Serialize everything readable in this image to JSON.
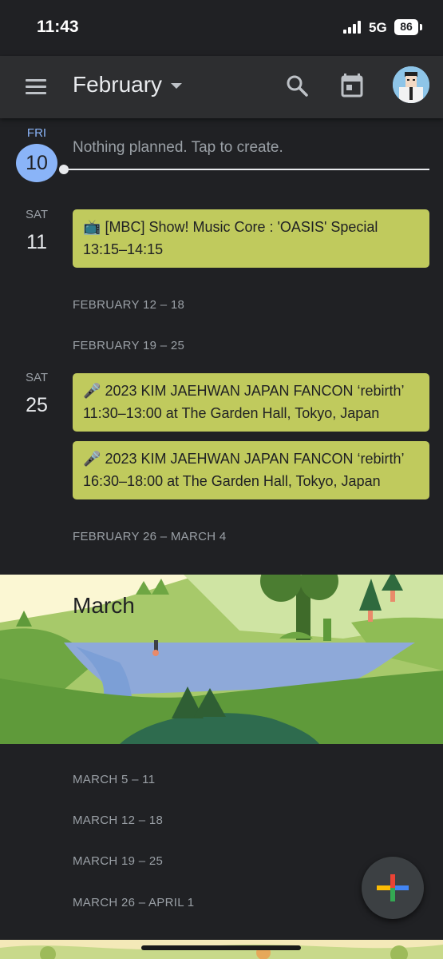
{
  "status_bar": {
    "time": "11:43",
    "network": "5G",
    "battery": "86"
  },
  "app_bar": {
    "title": "February",
    "icons": [
      "menu-icon",
      "search-icon",
      "calendar-today-icon",
      "avatar"
    ]
  },
  "colors": {
    "event": "#c0ca5d",
    "today": "#8ab4f8",
    "background": "#202124",
    "appbar": "#2d2e30"
  },
  "days": [
    {
      "dow": "FRI",
      "dom": "10",
      "today": true,
      "placeholder": "Nothing planned. Tap to create."
    },
    {
      "dow": "SAT",
      "dom": "11"
    },
    {
      "dow": "SAT",
      "dom": "25"
    }
  ],
  "events": [
    {
      "icon": "📺",
      "title": "[MBC] Show! Music Core : 'OASIS' Special",
      "time": "13:15–14:15"
    },
    {
      "icon": "🎤",
      "title": "2023 KIM JAEHWAN JAPAN FANCON ‘rebirth’",
      "time": "11:30–13:00 at The Garden Hall, Tokyo, Japan"
    },
    {
      "icon": "🎤",
      "title": "2023 KIM JAEHWAN JAPAN FANCON ‘rebirth’",
      "time": "16:30–18:00 at The Garden Hall, Tokyo, Japan"
    }
  ],
  "weeks": {
    "feb_12": "FEBRUARY 12 – 18",
    "feb_19": "FEBRUARY 19 – 25",
    "feb_26": "FEBRUARY 26 – MARCH 4",
    "mar_5": "MARCH 5 – 11",
    "mar_12": "MARCH 12 – 18",
    "mar_19": "MARCH 19 – 25",
    "mar_26": "MARCH 26 – APRIL 1"
  },
  "month_banner": {
    "title": "March"
  },
  "fab": {
    "icon": "plus-icon"
  }
}
